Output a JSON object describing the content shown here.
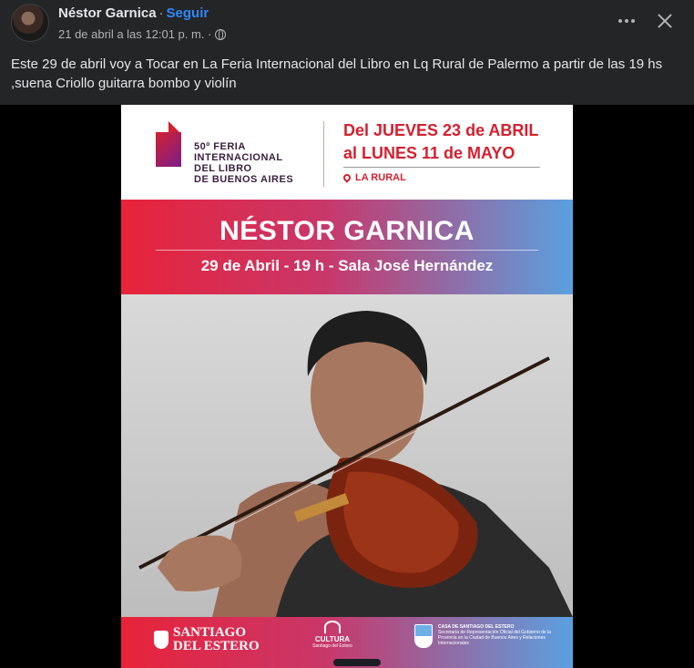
{
  "post": {
    "author": "Néstor Garnica",
    "separator": "·",
    "follow_label": "Seguir",
    "timestamp": "21 de abril a las 12:01 p. m. ·",
    "text": "Este 29 de abril voy a Tocar en La Feria Internacional del Libro en Lq Rural de Palermo a partir de las 19 hs ,suena Criollo guitarra bombo y violín"
  },
  "icons": {
    "globe": "globe-icon",
    "more": "more-icon",
    "close": "close-icon"
  },
  "poster": {
    "feria_lines": [
      "50º FERIA",
      "INTERNACIONAL",
      "DEL LIBRO",
      "DE BUENOS AIRES"
    ],
    "date_line_1": "Del JUEVES 23 de ABRIL",
    "date_line_2": "al LUNES 11 de MAYO",
    "venue": "LA RURAL",
    "artist": "NÉSTOR GARNICA",
    "event_line": "29 de Abril - 19 h - Sala José Hernández",
    "footer": {
      "sde_line_1": "SANTIAGO",
      "sde_line_2": "DEL ESTERO",
      "cultura": "CULTURA",
      "cultura_sub": "Santiago del Estero",
      "casa_title": "CASA DE SANTIAGO DEL ESTERO",
      "casa_text": "Secretaría de Representación Oficial del Gobierno de la Provincia en la Ciudad de Buenos Aires y Relaciones Internacionales"
    }
  },
  "colors": {
    "background": "#242526",
    "accent_blue": "#2d88ff",
    "poster_red": "#e8233a",
    "poster_blue": "#5aa0e0"
  }
}
